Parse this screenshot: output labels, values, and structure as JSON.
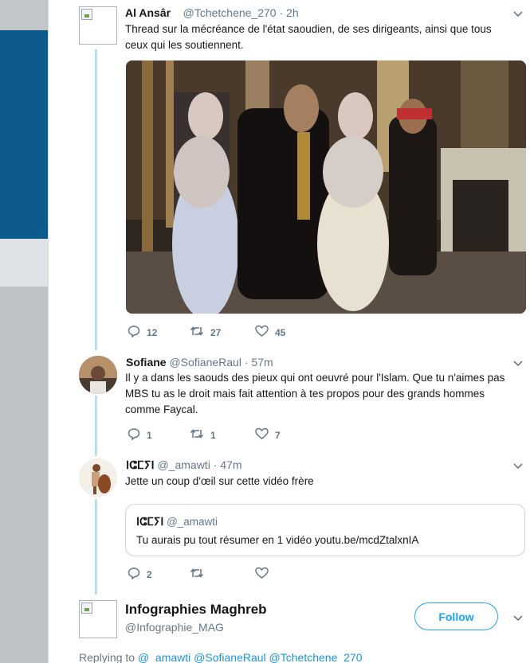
{
  "colors": {
    "accent": "#1da1f2",
    "thread_line": "#b9ddf3",
    "muted": "#657786"
  },
  "main_tweet": {
    "name": "Al Ansâr",
    "handle": "@Tchetchene_270",
    "dot": "·",
    "time": "2h",
    "text_line1": "Thread sur la mécréance de l'état saoudien, de ses dirigeants, ainsi que tous",
    "text_line2": "ceux qui les soutiennent.",
    "actions": {
      "replies": "12",
      "retweets": "27",
      "likes": "45"
    }
  },
  "reply_sofiane": {
    "name": "Sofiane",
    "handle": "@SofianeRaul",
    "dot": "·",
    "time": "57m",
    "text_line1": "Il y a dans les saouds des pieux qui ont oeuvré pour l'Islam. Que tu n'aimes pas",
    "text_line2": "MBS tu as le droit mais fait attention à tes propos pour des grands hommes",
    "text_line3": "comme Faycal.",
    "actions": {
      "replies": "1",
      "retweets": "1",
      "likes": "7"
    }
  },
  "reply_amawti": {
    "name": "ⵏⵛⵎⵢⵏ",
    "handle": "@_amawti",
    "dot": "·",
    "time": "47m",
    "text": "Jette un coup d'œil sur cette vidéo frère",
    "quote": {
      "name": "ⵏⵛⵎⵢⵏ",
      "handle": "@_amawti",
      "text": "Tu aurais pu tout résumer en 1 vidéo youtu.be/mcdZtalxnIA"
    },
    "actions": {
      "replies": "2",
      "retweets": "",
      "likes": ""
    }
  },
  "compose": {
    "name": "Infographies Maghreb",
    "handle": "@Infographie_MAG",
    "follow_label": "Follow",
    "replying_prefix": "Replying to",
    "replying_handles": "@_amawti @SofianeRaul @Tchetchene_270"
  }
}
